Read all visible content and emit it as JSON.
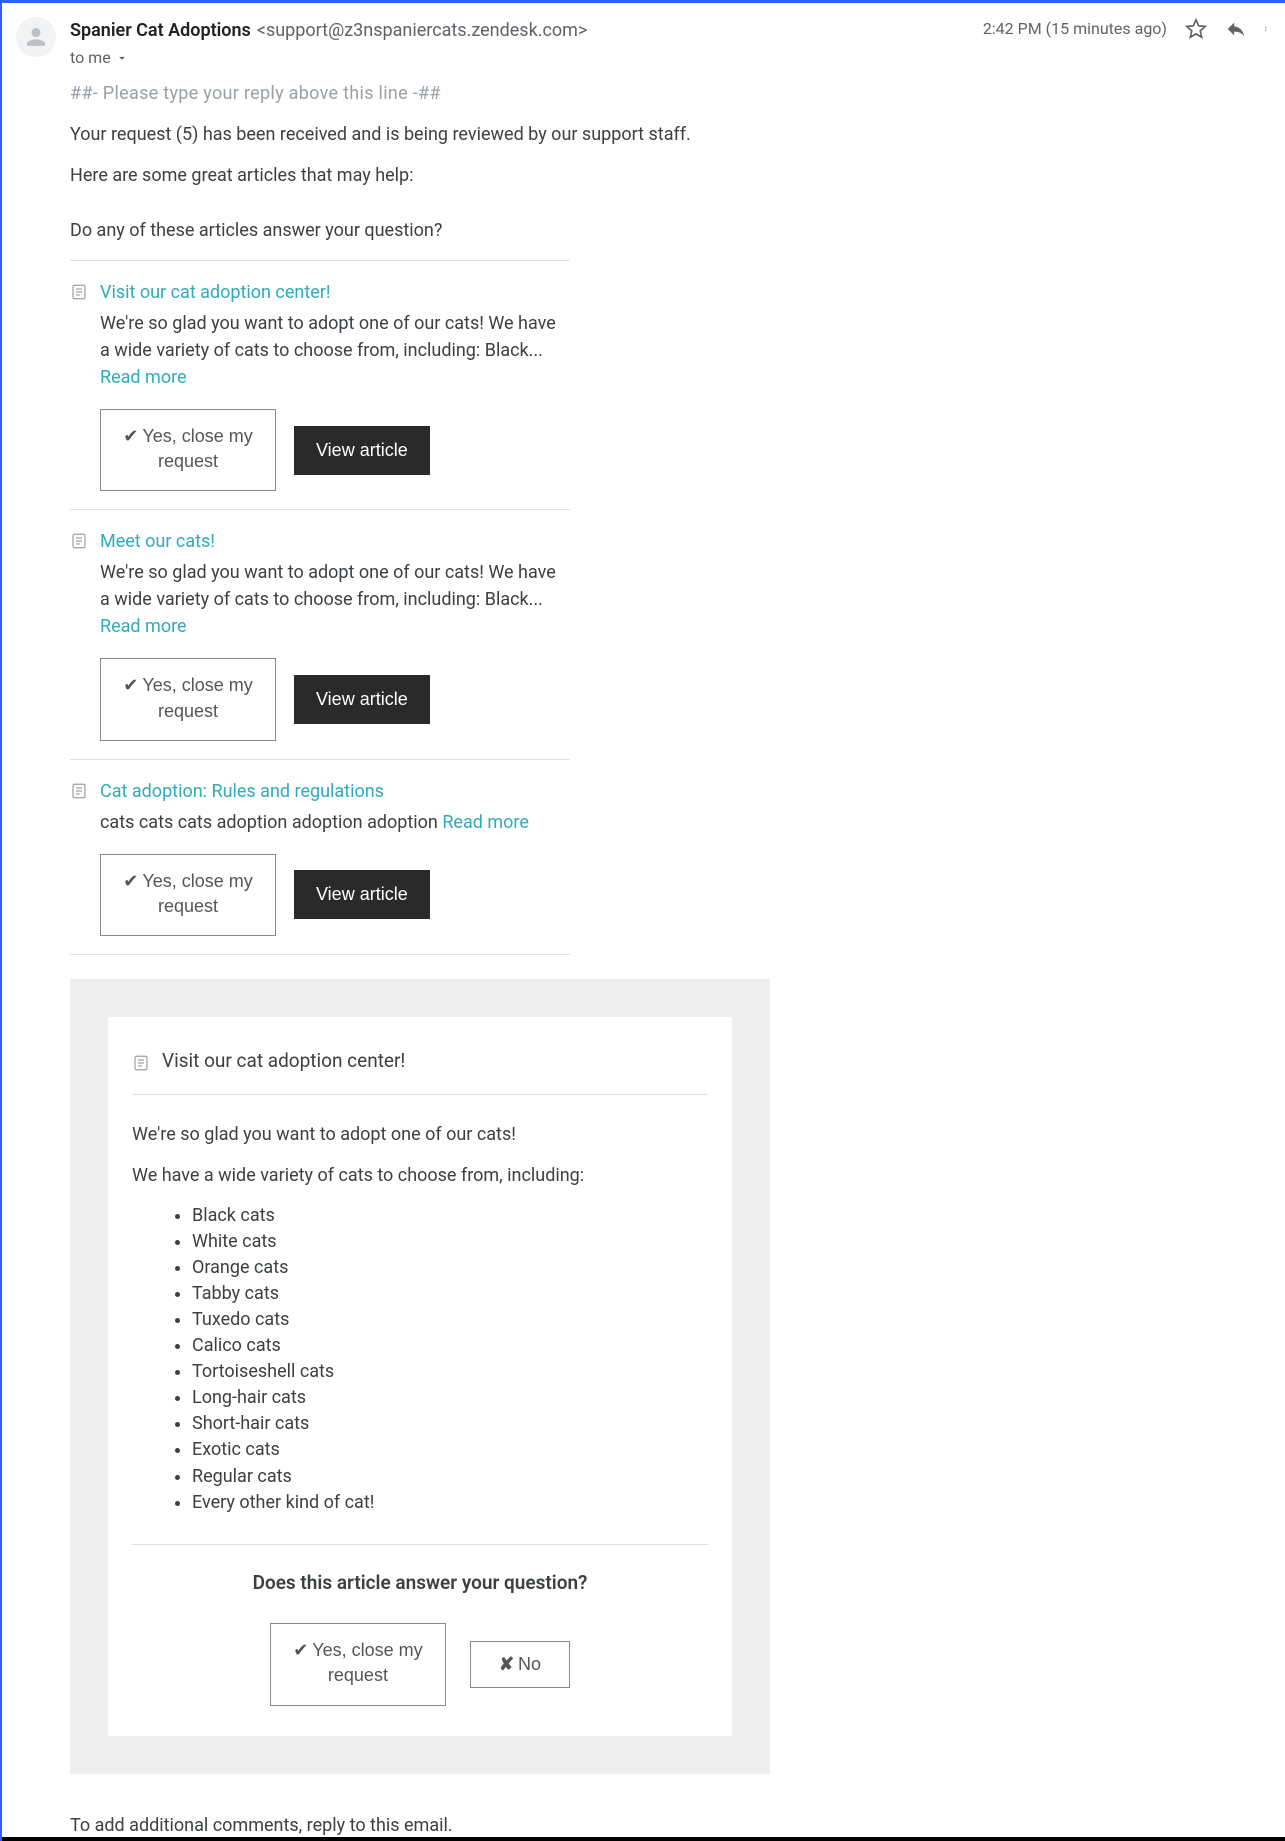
{
  "header": {
    "sender_name": "Spanier Cat Adoptions",
    "sender_email": "<support@z3nspaniercats.zendesk.com>",
    "to_line": "to me",
    "timestamp": "2:42 PM (15 minutes ago)"
  },
  "body": {
    "reply_marker": "##- Please type your reply above this line -##",
    "para1": "Your request (5) has been received and is being reviewed by our support staff.",
    "para2": "Here are some great articles that may help:",
    "question": "Do any of these articles answer your question?"
  },
  "articles": [
    {
      "title": "Visit our cat adoption center!",
      "snippet": "We're so glad you want to adopt one of our cats!  We have a wide variety of cats to choose from, including: Black... ",
      "read_more": "Read more",
      "yes_label_1": "Yes, close my",
      "yes_label_2": "request",
      "view_label": "View article"
    },
    {
      "title": "Meet our cats!",
      "snippet": "We're so glad you want to adopt one of our cats!  We have a wide variety of cats to choose from, including: Black... ",
      "read_more": "Read more",
      "yes_label_1": "Yes, close my",
      "yes_label_2": "request",
      "view_label": "View article"
    },
    {
      "title": "Cat adoption: Rules and regulations",
      "snippet": "cats cats cats adoption adoption adoption ",
      "read_more": "Read more",
      "yes_label_1": "Yes, close my",
      "yes_label_2": "request",
      "view_label": "View article"
    }
  ],
  "expanded": {
    "title": "Visit our cat adoption center!",
    "p1": "We're so glad you want to adopt one of our cats!",
    "p2": "We have a wide variety of cats to choose from, including:",
    "items": [
      "Black cats",
      "White cats",
      "Orange cats",
      "Tabby cats",
      "Tuxedo cats",
      "Calico cats",
      "Tortoiseshell cats",
      "Long-hair cats",
      "Short-hair cats",
      "Exotic cats",
      "Regular cats",
      "Every other kind of cat!"
    ],
    "question": "Does this article answer your question?",
    "yes_label_1": "Yes, close my",
    "yes_label_2": "request",
    "no_label": "No"
  },
  "footer": {
    "note": "To add additional comments, reply to this email."
  }
}
